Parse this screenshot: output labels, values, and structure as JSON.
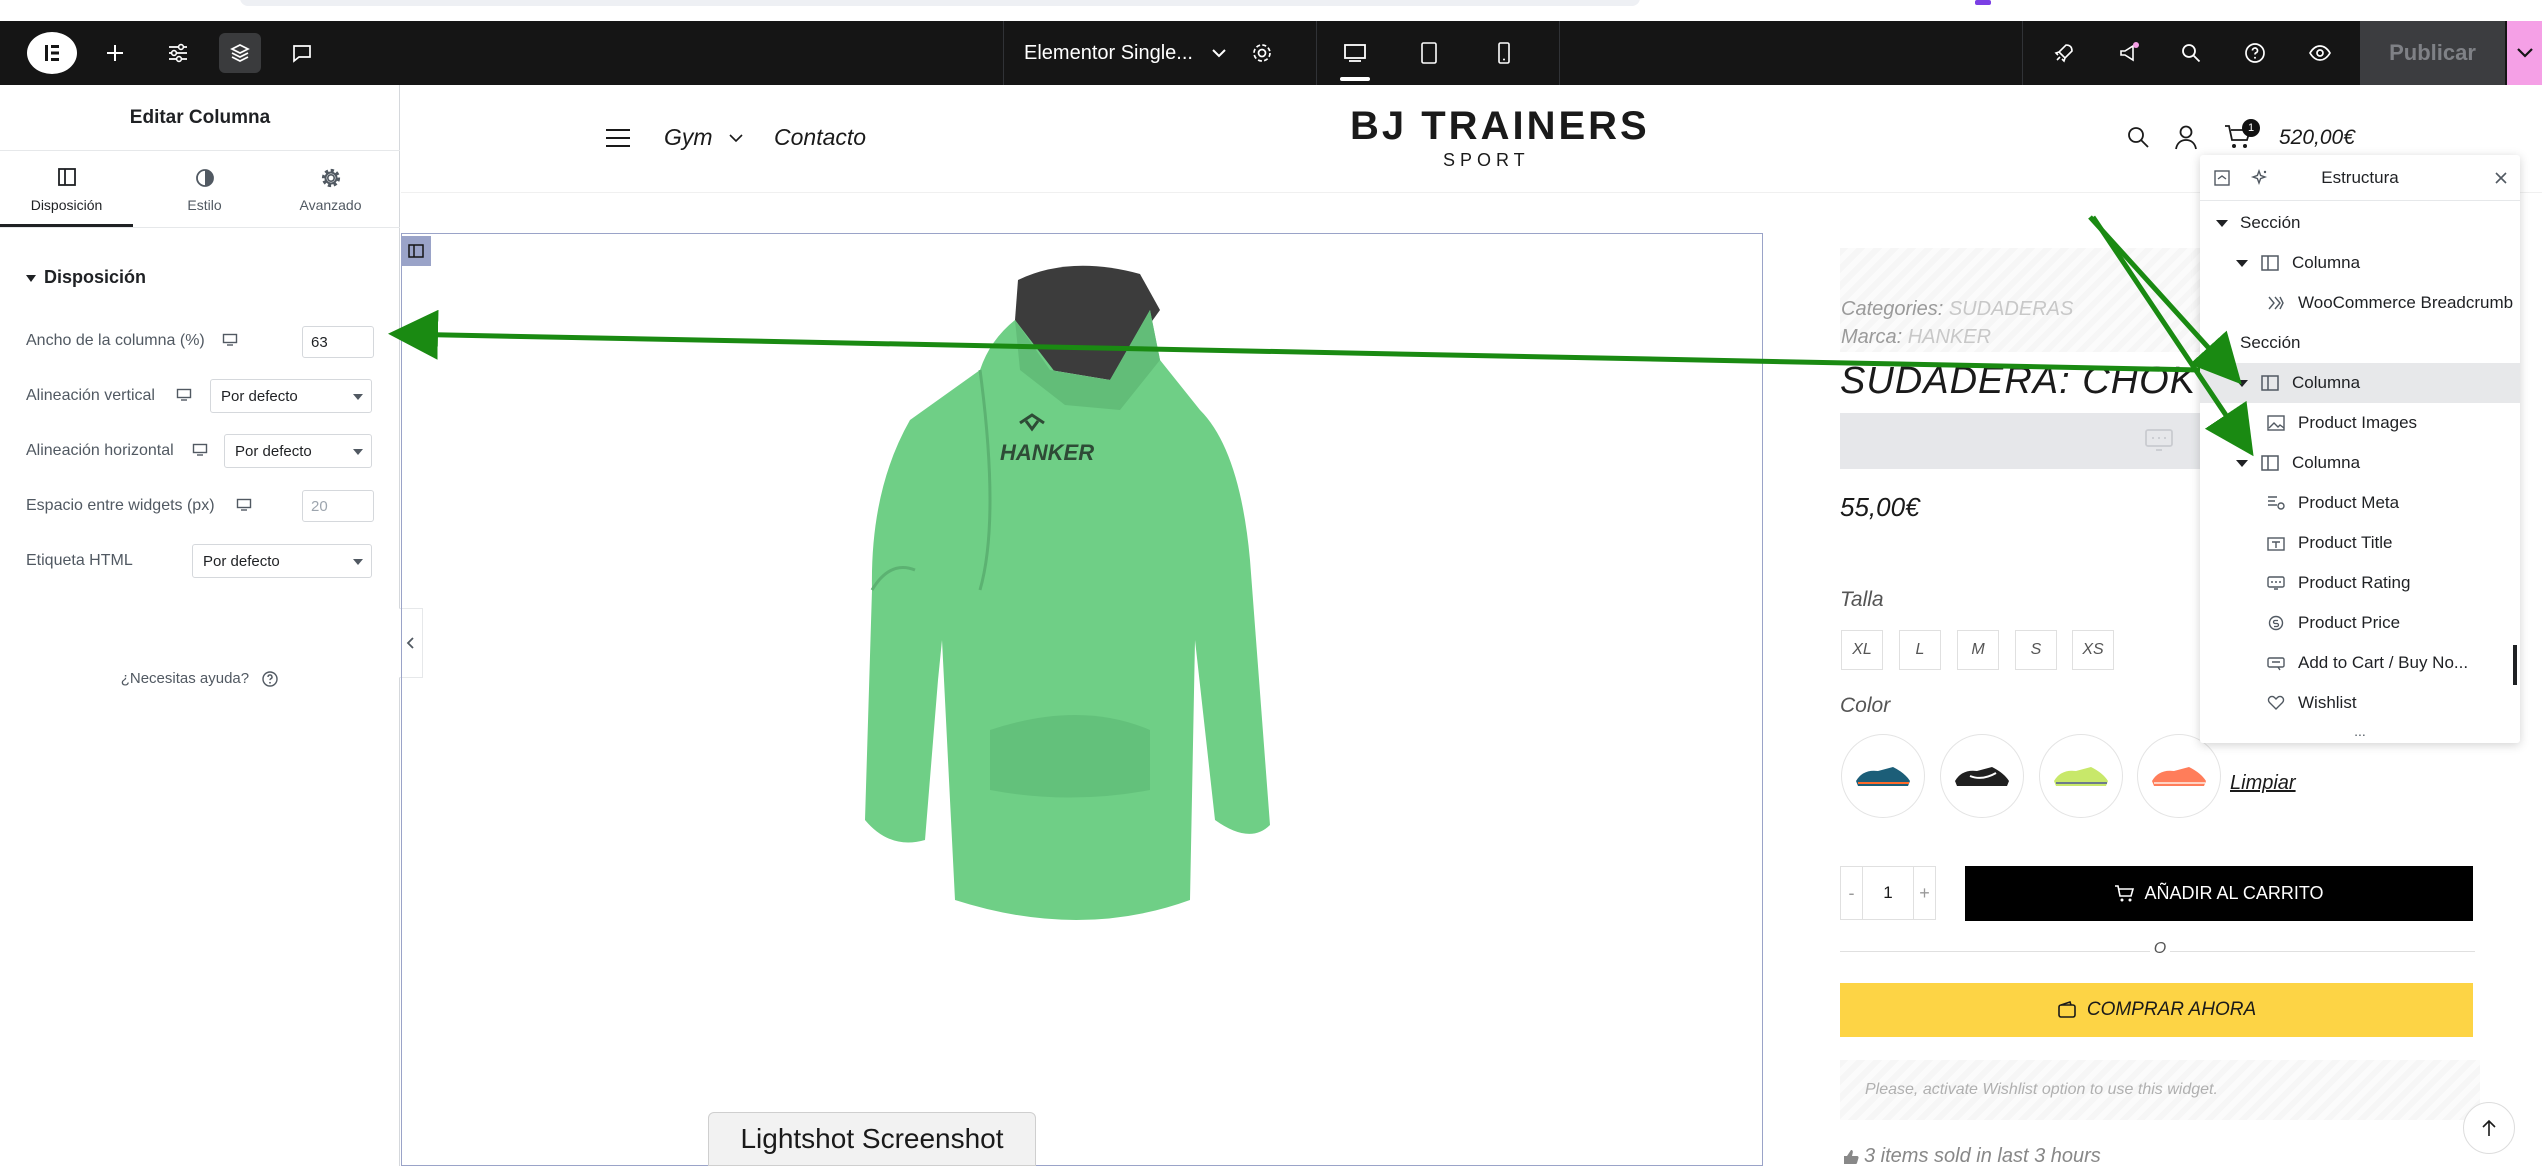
{
  "editor": {
    "page_title": "Elementor Single...",
    "publish_label": "Publicar"
  },
  "left_panel": {
    "title": "Editar Columna",
    "tabs": [
      {
        "label": "Disposición",
        "icon": "layout-icon",
        "active": true
      },
      {
        "label": "Estilo",
        "icon": "half-circle-icon",
        "active": false
      },
      {
        "label": "Avanzado",
        "icon": "gear-icon",
        "active": false
      }
    ],
    "section_title": "Disposición",
    "controls": {
      "width_label": "Ancho de la columna (%)",
      "width_value": "63",
      "valign_label": "Alineación vertical",
      "valign_value": "Por defecto",
      "halign_label": "Alineación horizontal",
      "halign_value": "Por defecto",
      "spacing_label": "Espacio entre widgets (px)",
      "spacing_placeholder": "20",
      "html_tag_label": "Etiqueta HTML",
      "html_tag_value": "Por defecto"
    },
    "help": "¿Necesitas ayuda?"
  },
  "site": {
    "nav": {
      "gym": "Gym",
      "contact": "Contacto"
    },
    "brand_main": "BJ TRAINERS",
    "brand_sub": "SPORT",
    "cart_count": "1",
    "cart_total": "520,00€",
    "hoodie_print": "HANKER"
  },
  "product": {
    "categories_label": "Categories:",
    "categories_value": "SUDADERAS",
    "brand_label": "Marca:",
    "brand_value": "HANKER",
    "title": "SUDADERA: CHOK",
    "price": "55,00€",
    "size_label": "Talla",
    "sizes": [
      "XL",
      "L",
      "M",
      "S",
      "XS"
    ],
    "color_label": "Color",
    "clear": "Limpiar",
    "qty_minus": "-",
    "qty": "1",
    "qty_plus": "+",
    "add_to_cart": "AÑADIR AL CARRITO",
    "or": "O",
    "buy_now": "COMPRAR AHORA",
    "wishlist_notice": "Please, activate Wishlist option to use this widget.",
    "sold_notice": "3 items sold in last 3 hours"
  },
  "structure": {
    "title": "Estructura",
    "items": [
      {
        "label": "Sección",
        "icon": "caret-down-icon"
      },
      {
        "label": "Columna",
        "icon": "column-icon"
      },
      {
        "label": "WooCommerce Breadcrumb",
        "icon": "breadcrumb-icon"
      },
      {
        "label": "Sección",
        "icon": "caret-down-icon"
      },
      {
        "label": "Columna",
        "icon": "column-icon",
        "selected": true
      },
      {
        "label": "Product Images",
        "icon": "image-icon"
      },
      {
        "label": "Columna",
        "icon": "column-icon"
      },
      {
        "label": "Product Meta",
        "icon": "meta-icon"
      },
      {
        "label": "Product Title",
        "icon": "title-icon"
      },
      {
        "label": "Product Rating",
        "icon": "rating-icon"
      },
      {
        "label": "Product Price",
        "icon": "price-icon"
      },
      {
        "label": "Add to Cart / Buy No...",
        "icon": "cart-button-icon"
      },
      {
        "label": "Wishlist",
        "icon": "heart-icon"
      }
    ],
    "more": "..."
  },
  "overlay": {
    "lightshot": "Lightshot Screenshot",
    "arrow_color": "#1a8a12"
  },
  "colors": {
    "topbar": "#151515",
    "buy_now": "#fdd445",
    "accent_pink": "#f5a0e6"
  }
}
